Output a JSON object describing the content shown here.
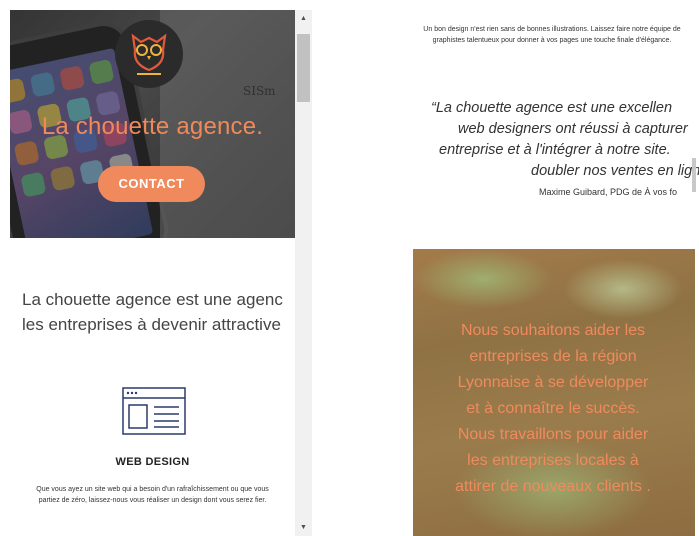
{
  "left_pane": {
    "hero": {
      "sketch_text": "SISm",
      "title": "La chouette agence.",
      "contact_label": "CONTACT"
    },
    "intro_lines": [
      "La chouette agence est une agenc",
      "les entreprises à devenir attractive"
    ],
    "service": {
      "icon": "web-design-icon",
      "title": "WEB DESIGN",
      "text": "Que vous ayez un site web qui a besoin d'un rafraîchissement ou que vous partiez de zéro, laissez-nous vous réaliser un design dont vous serez fier."
    },
    "scrollbar": {
      "up": "▲",
      "down": "▼"
    }
  },
  "right_pane": {
    "illustration_text": "Un bon design n'est rien sans de bonnes illustrations. Laissez faire notre équipe de graphistes talentueux pour donner à vos pages une touche finale d'élégance.",
    "quote_lines": [
      "“La chouette agence est une excellen",
      "web designers ont réussi à capturer",
      "entreprise et à l'intégrer à notre site.",
      "doubler nos ventes en ligne"
    ],
    "author": "Maxime Guibard, PDG de À vos fo",
    "mission_text": "Nous souhaitons aider les entreprises de la région Lyonnaise à se développer et à connaître le succès. Nous travaillons pour aider les entreprises locales à attirer de nouveaux clients ."
  },
  "colors": {
    "accent": "#f08a5d",
    "hero_dark": "#3b3b3b",
    "text": "#444444"
  }
}
